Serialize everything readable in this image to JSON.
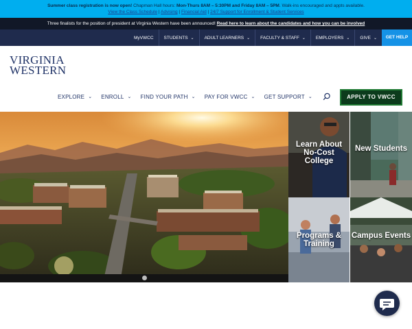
{
  "alert": {
    "bold1": "Summer class registration is now open!",
    "text1": " Chapman Hall hours: ",
    "bold2": "Mon-Thurs 8AM – 5:30PM and Friday 8AM – 5PM",
    "text2": ". Walk-ins encouraged and appts available.",
    "links": [
      "View the Class Schedule",
      "Advising",
      "Financial Aid",
      "24/7 Support for Enrollment & Student Services"
    ]
  },
  "announcement": {
    "text": "Three finalists for the position of president at Virginia Western have been announced! ",
    "link": "Read here to learn about the candidates and how you can be involved"
  },
  "utility_nav": {
    "items": [
      {
        "label": "MyVWCC",
        "dropdown": false
      },
      {
        "label": "STUDENTS",
        "dropdown": true
      },
      {
        "label": "ADULT LEARNERS",
        "dropdown": true
      },
      {
        "label": "FACULTY & STAFF",
        "dropdown": true
      },
      {
        "label": "EMPLOYERS",
        "dropdown": true
      },
      {
        "label": "GIVE",
        "dropdown": true
      }
    ],
    "help_label": "GET HELP"
  },
  "logo": {
    "line1": "VIRGINIA",
    "line2": "WESTERN"
  },
  "main_nav": {
    "items": [
      {
        "label": "EXPLORE"
      },
      {
        "label": "ENROLL"
      },
      {
        "label": "FIND YOUR PATH"
      },
      {
        "label": "PAY FOR VWCC"
      },
      {
        "label": "GET SUPPORT"
      }
    ],
    "apply_label": "APPLY TO VWCC"
  },
  "tiles": [
    {
      "label": "Learn About No-Cost College"
    },
    {
      "label": "New Students"
    },
    {
      "label": "Programs & Training"
    },
    {
      "label": "Campus Events"
    }
  ],
  "colors": {
    "alert_bg": "#00aeef",
    "announce_bg": "#111827",
    "nav_bg": "#1f2b4d",
    "help_bg": "#1592e6",
    "brand_navy": "#1f3266",
    "apply_bg": "#0c3b1c"
  },
  "icons": [
    "search-icon",
    "chevron-down-icon",
    "chat-icon"
  ]
}
